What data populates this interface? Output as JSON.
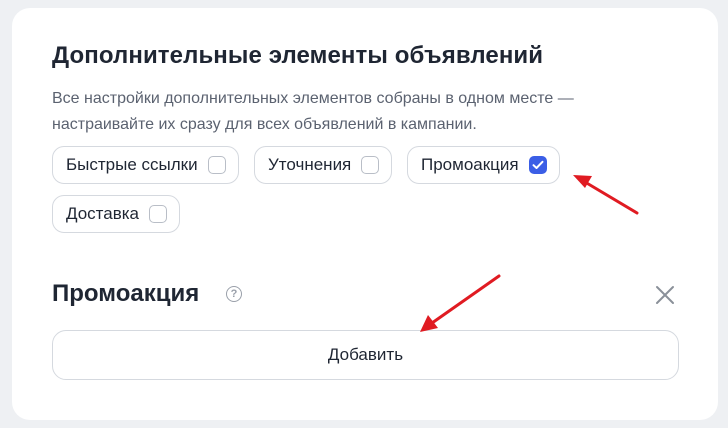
{
  "panel": {
    "title": "Дополнительные элементы объявлений",
    "description": "Все настройки дополнительных элементов собраны в одном месте — настраивайте их сразу для всех объявлений в кампании."
  },
  "chips": [
    {
      "label": "Быстрые ссылки",
      "checked": false
    },
    {
      "label": "Уточнения",
      "checked": false
    },
    {
      "label": "Промоакция",
      "checked": true
    },
    {
      "label": "Доставка",
      "checked": false
    }
  ],
  "promo_section": {
    "title": "Промоакция",
    "help_icon": "question-circle-icon",
    "close_icon": "close-icon",
    "add_label": "Добавить"
  },
  "colors": {
    "accent": "#3b5ee6",
    "annotation_arrow": "#e01b22"
  }
}
